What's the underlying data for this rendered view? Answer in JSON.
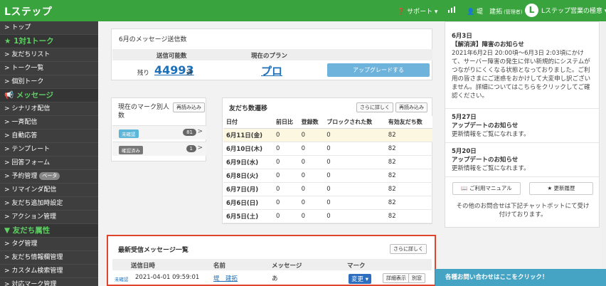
{
  "header": {
    "logo": "Lステップ",
    "support": "❓ サポート ▾",
    "chart_icon": "bar-chart-icon",
    "user_name": "👤 堤　建拓",
    "user_role": "(管理者)",
    "account_initial": "L",
    "account_name": "Lステップ営業の極意 ▾"
  },
  "sidebar": {
    "items": [
      {
        "label": "> トップ",
        "type": "link"
      },
      {
        "label": "★ 1対1トーク",
        "type": "group"
      },
      {
        "label": "> 友だちリスト",
        "type": "link"
      },
      {
        "label": "> トーク一覧",
        "type": "link"
      },
      {
        "label": "> 個別トーク",
        "type": "link"
      },
      {
        "label": "📢 メッセージ",
        "type": "group"
      },
      {
        "label": "> シナリオ配信",
        "type": "link"
      },
      {
        "label": "> 一斉配信",
        "type": "link"
      },
      {
        "label": "> 自動応答",
        "type": "link"
      },
      {
        "label": "> テンプレート",
        "type": "link"
      },
      {
        "label": "> 回答フォーム",
        "type": "link"
      },
      {
        "label": "> 予約管理",
        "type": "link",
        "badge": "ベータ"
      },
      {
        "label": "> リマインダ配信",
        "type": "link"
      },
      {
        "label": "> 友だち追加時設定",
        "type": "link"
      },
      {
        "label": "> アクション管理",
        "type": "link"
      },
      {
        "label": "▼ 友だち属性",
        "type": "group"
      },
      {
        "label": "> タグ管理",
        "type": "link"
      },
      {
        "label": "> 友だち情報欄管理",
        "type": "link"
      },
      {
        "label": "> カスタム検索管理",
        "type": "link"
      },
      {
        "label": "> 対応マーク管理",
        "type": "link"
      }
    ]
  },
  "send_panel": {
    "title": "6月のメッセージ送信数",
    "col_available": "送信可能数",
    "col_plan": "現在のプラン",
    "remain_label": "残り",
    "remain_value": "44993",
    "remain_unit": "通",
    "plan_value": "プロ",
    "upgrade_label": "アップグレードする"
  },
  "mark_panel": {
    "title": "現在のマーク別人数",
    "reload": "再読み込み",
    "rows": [
      {
        "badge": "未確認",
        "color": "#5cb6d8",
        "count": "81"
      },
      {
        "badge": "確認済み",
        "color": "#777777",
        "count": "1"
      }
    ]
  },
  "friends_panel": {
    "title": "友だち数遷移",
    "more": "さらに詳しく",
    "reload": "再読み込み",
    "headers": [
      "日付",
      "前日比",
      "登録数",
      "ブロックされた数",
      "有効友だち数"
    ],
    "rows": [
      [
        "6月11日(金)",
        "0",
        "0",
        "0",
        "82"
      ],
      [
        "6月10日(木)",
        "0",
        "0",
        "0",
        "82"
      ],
      [
        "6月9日(水)",
        "0",
        "0",
        "0",
        "82"
      ],
      [
        "6月8日(火)",
        "0",
        "0",
        "0",
        "82"
      ],
      [
        "6月7日(月)",
        "0",
        "0",
        "0",
        "82"
      ],
      [
        "6月6日(日)",
        "0",
        "0",
        "0",
        "82"
      ],
      [
        "6月5日(土)",
        "0",
        "0",
        "0",
        "82"
      ]
    ]
  },
  "recent_panel": {
    "title": "最新受信メッセージ一覧",
    "more": "さらに詳しく",
    "headers": [
      "送信日時",
      "名前",
      "メッセージ",
      "マーク"
    ],
    "row": {
      "status": "未確認",
      "datetime": "2021-04-01 09:59:01",
      "name": "堤　建拓",
      "message": "あ",
      "mark_button": "変更 ▾",
      "detail_button": "詳細表示",
      "other_button": "別窓"
    }
  },
  "notices": [
    {
      "date": "6月3日",
      "title": "【解消済】障害のお知らせ",
      "body": "2021年6月2日 20:00頃〜6月3日 2:03頃にかけて、サーバー障害の発生に伴い新規的にシステムがつながりにくくなる状態となっておりました。ご利用の皆さまにご迷惑をおかけして大変申し訳ございません。詳細についてはこちらをクリックしてご確認ください。"
    },
    {
      "date": "5月27日",
      "title": "アップデートのお知らせ",
      "body": "更新情報をご覧になれます。"
    },
    {
      "date": "5月20日",
      "title": "アップデートのお知らせ",
      "body": "更新情報をご覧になれます。"
    }
  ],
  "right_buttons": {
    "manual": "📖 ご利用マニュアル",
    "history": "★ 更新履歴"
  },
  "right_note": "その他のお問合せは下記チャットボットにて受け付けております。",
  "contact_bar": "各種お問い合わせはここをクリック！"
}
